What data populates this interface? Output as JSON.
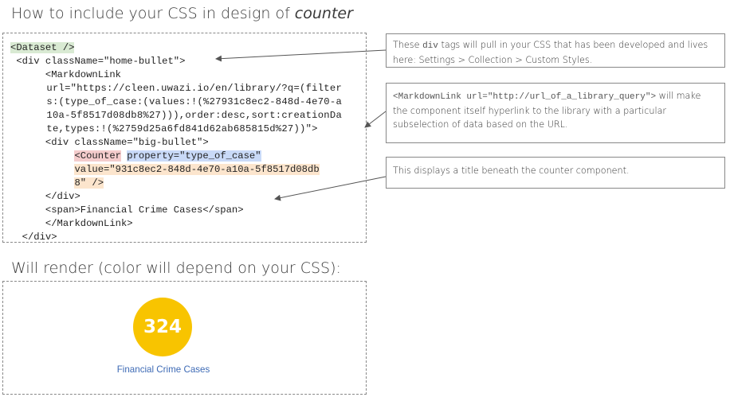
{
  "headings": {
    "title_prefix": "How to include your CSS in design of ",
    "title_emphasis": "counter",
    "render_title": "Will render (color will depend on your CSS):"
  },
  "code": {
    "line1": "<Dataset />",
    "line2": " <div className=\"home-bullet\">",
    "line3": "      <MarkdownLink",
    "line4": "      url=\"https://cleen.uwazi.io/en/library/?q=(filter",
    "line5": "      s:(type_of_case:(values:!(%27931c8ec2-848d-4e70-a",
    "line6": "      10a-5f8517d08db8%27))),order:desc,sort:creationDa",
    "line7": "      te,types:!(%2759d25a6fd841d62ab685815d%27))\">",
    "line8": "      <div className=\"big-bullet\">",
    "line9_indent": "           ",
    "line9_counter": "<Counter",
    "line9_space": " ",
    "line9_property": "property=\"type_of_case\"",
    "line10_indent": "           ",
    "line10_value": "value=\"931c8ec2-848d-4e70-a10a-5f8517d08db",
    "line11_indent": "           ",
    "line11_value": "8\" />",
    "line12": "      </div>",
    "line13": "      <span>Financial Crime Cases</span>",
    "line14": "      </MarkdownLink>",
    "line15": "  </div>"
  },
  "notes": {
    "n1_a": "These ",
    "n1_mono": "div",
    "n1_b": " tags will pull in your CSS that has been developed and lives here: Settings > Collection > Custom Styles.",
    "n2_mono": "<MarkdownLink url=\"http://url_of_a_library_query\">",
    "n2_b": " will make the component itself hyperlink to the library with a particular subselection of data based on the URL.",
    "n3": "This displays a title beneath the counter component."
  },
  "render": {
    "count": "324",
    "label": "Financial Crime Cases"
  },
  "colors": {
    "counter_yellow": "#f8c400",
    "label_blue": "#3d6ab5",
    "highlight_green": "#d9ead3",
    "highlight_red": "#f4cccc",
    "highlight_blue": "#c9daf8",
    "highlight_orange": "#fce5cd"
  }
}
